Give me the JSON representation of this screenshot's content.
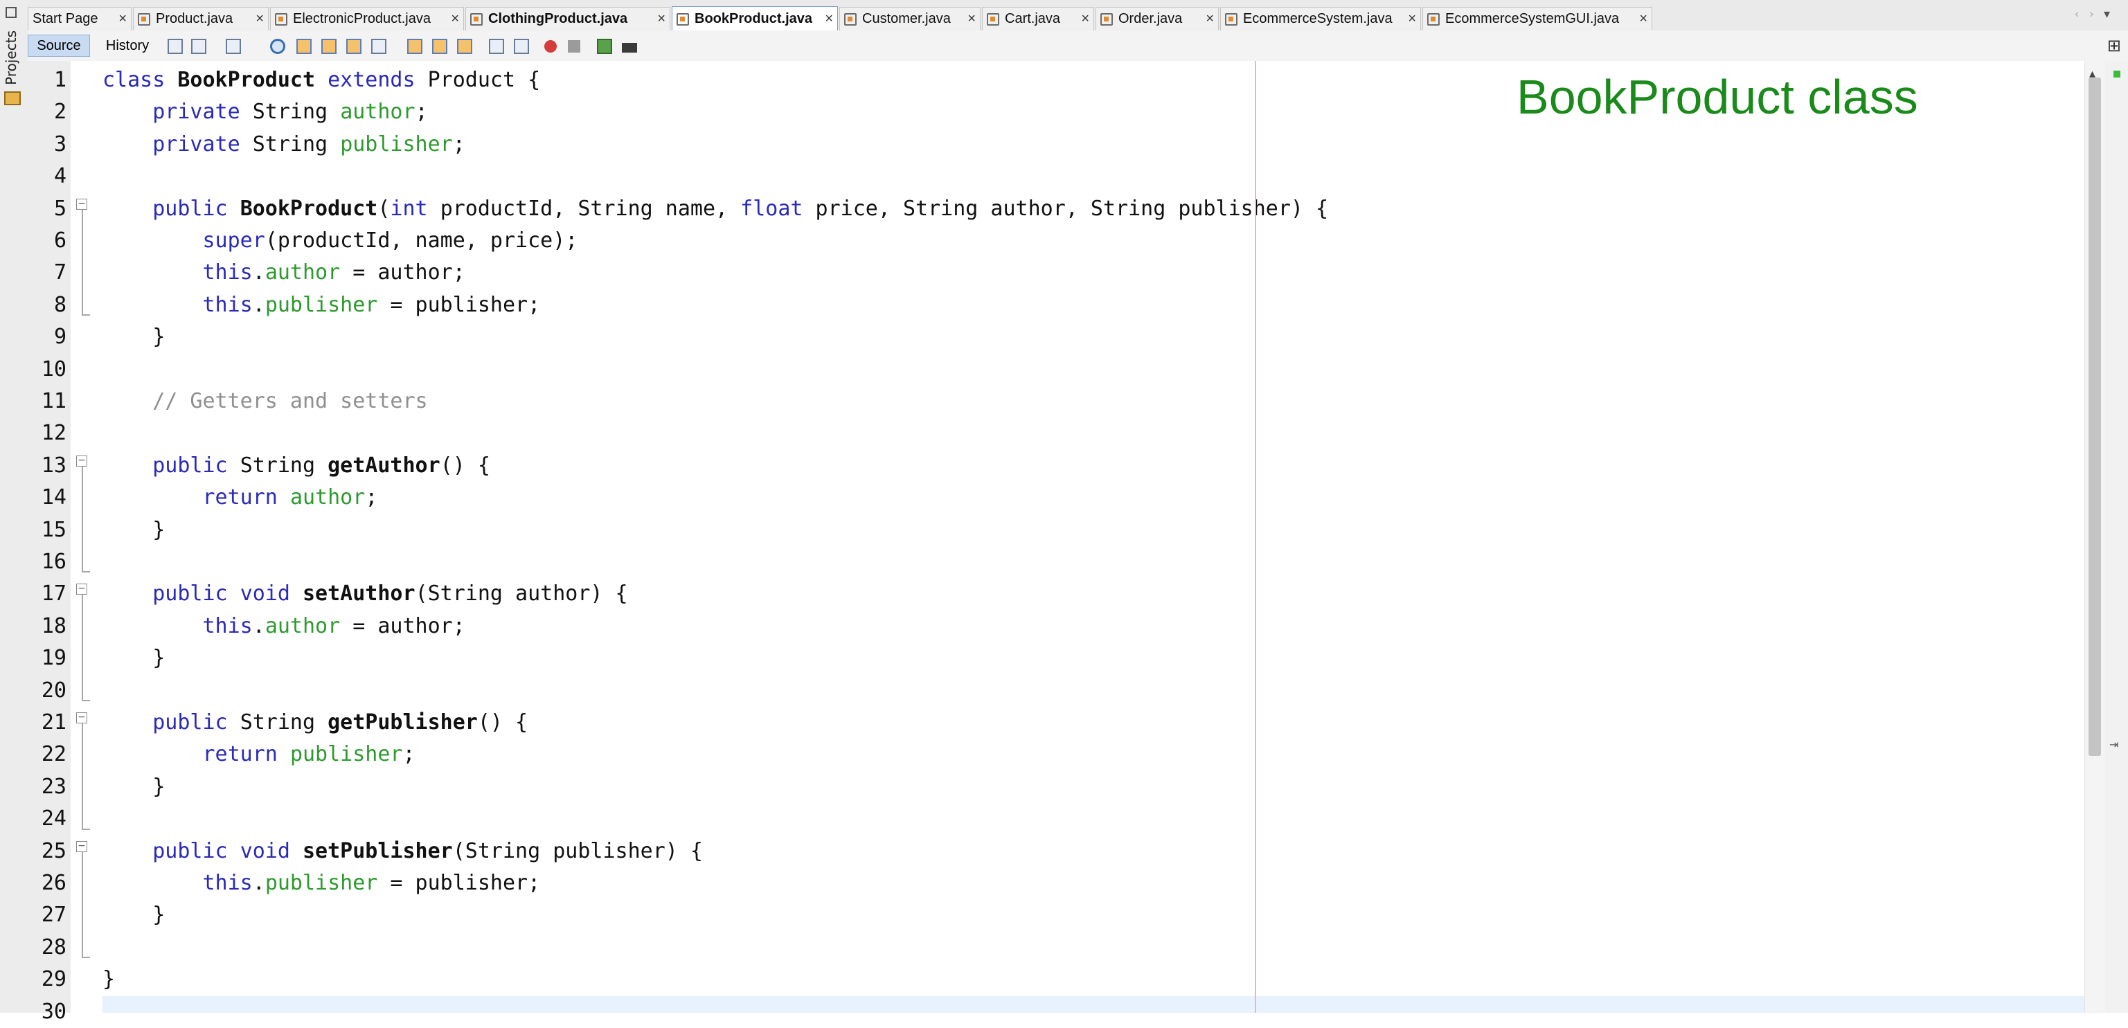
{
  "window": {
    "projects_label": "Projects"
  },
  "tabs": [
    {
      "label": "Start Page",
      "bold": false,
      "active": false
    },
    {
      "label": "Product.java",
      "bold": false,
      "active": false
    },
    {
      "label": "ElectronicProduct.java",
      "bold": false,
      "active": false
    },
    {
      "label": "ClothingProduct.java",
      "bold": true,
      "active": false
    },
    {
      "label": "BookProduct.java",
      "bold": true,
      "active": true
    },
    {
      "label": "Customer.java",
      "bold": false,
      "active": false
    },
    {
      "label": "Cart.java",
      "bold": false,
      "active": false
    },
    {
      "label": "Order.java",
      "bold": false,
      "active": false
    },
    {
      "label": "EcommerceSystem.java",
      "bold": false,
      "active": false
    },
    {
      "label": "EcommerceSystemGUI.java",
      "bold": false,
      "active": false
    }
  ],
  "tab_close_glyph": "×",
  "toolbar": {
    "source_label": "Source",
    "history_label": "History"
  },
  "annotation": "BookProduct class",
  "lines": [
    [
      [
        "kw",
        "class "
      ],
      [
        "b",
        "BookProduct "
      ],
      [
        "kw",
        "extends "
      ],
      [
        "",
        "Product {"
      ]
    ],
    [
      [
        "",
        "    "
      ],
      [
        "kw",
        "private "
      ],
      [
        "",
        "String "
      ],
      [
        "fld",
        "author"
      ],
      [
        "",
        ";"
      ]
    ],
    [
      [
        "",
        "    "
      ],
      [
        "kw",
        "private "
      ],
      [
        "",
        "String "
      ],
      [
        "fld",
        "publisher"
      ],
      [
        "",
        ";"
      ]
    ],
    [],
    [
      [
        "",
        "    "
      ],
      [
        "kw",
        "public "
      ],
      [
        "b",
        "BookProduct"
      ],
      [
        "",
        "("
      ],
      [
        "kw",
        "int "
      ],
      [
        "",
        "productId, String name, "
      ],
      [
        "kw",
        "float "
      ],
      [
        "",
        "price, String author, String publisher) {"
      ]
    ],
    [
      [
        "",
        "        "
      ],
      [
        "kw",
        "super"
      ],
      [
        "",
        "(productId, name, price);"
      ]
    ],
    [
      [
        "",
        "        "
      ],
      [
        "kw",
        "this"
      ],
      [
        "",
        "."
      ],
      [
        "fld",
        "author"
      ],
      [
        "",
        " = author;"
      ]
    ],
    [
      [
        "",
        "        "
      ],
      [
        "kw",
        "this"
      ],
      [
        "",
        "."
      ],
      [
        "fld",
        "publisher"
      ],
      [
        "",
        " = publisher;"
      ]
    ],
    [
      [
        "",
        "    }"
      ]
    ],
    [],
    [
      [
        "",
        "    "
      ],
      [
        "cmt",
        "// Getters and setters"
      ]
    ],
    [],
    [
      [
        "",
        "    "
      ],
      [
        "kw",
        "public "
      ],
      [
        "",
        "String "
      ],
      [
        "b",
        "getAuthor"
      ],
      [
        "",
        "() {"
      ]
    ],
    [
      [
        "",
        "        "
      ],
      [
        "kw",
        "return "
      ],
      [
        "fld",
        "author"
      ],
      [
        "",
        ";"
      ]
    ],
    [
      [
        "",
        "    }"
      ]
    ],
    [],
    [
      [
        "",
        "    "
      ],
      [
        "kw",
        "public "
      ],
      [
        "kw",
        "void "
      ],
      [
        "b",
        "setAuthor"
      ],
      [
        "",
        "(String author) {"
      ]
    ],
    [
      [
        "",
        "        "
      ],
      [
        "kw",
        "this"
      ],
      [
        "",
        "."
      ],
      [
        "fld",
        "author"
      ],
      [
        "",
        " = author;"
      ]
    ],
    [
      [
        "",
        "    }"
      ]
    ],
    [],
    [
      [
        "",
        "    "
      ],
      [
        "kw",
        "public "
      ],
      [
        "",
        "String "
      ],
      [
        "b",
        "getPublisher"
      ],
      [
        "",
        "() {"
      ]
    ],
    [
      [
        "",
        "        "
      ],
      [
        "kw",
        "return "
      ],
      [
        "fld",
        "publisher"
      ],
      [
        "",
        ";"
      ]
    ],
    [
      [
        "",
        "    }"
      ]
    ],
    [],
    [
      [
        "",
        "    "
      ],
      [
        "kw",
        "public "
      ],
      [
        "kw",
        "void "
      ],
      [
        "b",
        "setPublisher"
      ],
      [
        "",
        "(String publisher) {"
      ]
    ],
    [
      [
        "",
        "        "
      ],
      [
        "kw",
        "this"
      ],
      [
        "",
        "."
      ],
      [
        "fld",
        "publisher"
      ],
      [
        "",
        " = publisher;"
      ]
    ],
    [
      [
        "",
        "    }"
      ]
    ],
    [],
    [
      [
        "",
        "}"
      ]
    ],
    []
  ],
  "line_numbers": [
    "1",
    "2",
    "3",
    "4",
    "5",
    "6",
    "7",
    "8",
    "9",
    "10",
    "11",
    "12",
    "13",
    "14",
    "15",
    "16",
    "17",
    "18",
    "19",
    "20",
    "21",
    "22",
    "23",
    "24",
    "25",
    "26",
    "27",
    "28",
    "29",
    "30"
  ],
  "fold_lines": [
    5,
    13,
    17,
    21,
    25
  ],
  "fold_glyph": "−"
}
